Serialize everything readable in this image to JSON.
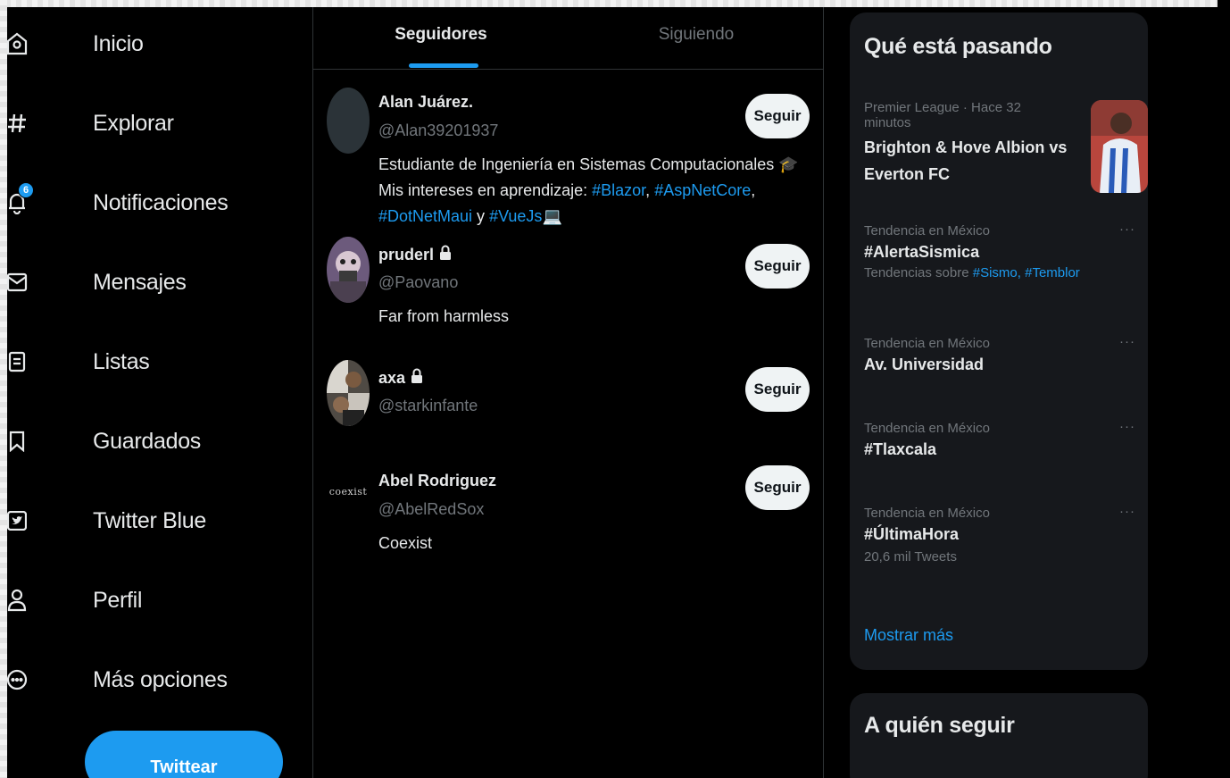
{
  "sidebar": {
    "items": [
      {
        "label": "Inicio",
        "icon": "home-icon"
      },
      {
        "label": "Explorar",
        "icon": "hashtag-icon"
      },
      {
        "label": "Notificaciones",
        "icon": "bell-icon",
        "badge": "6"
      },
      {
        "label": "Mensajes",
        "icon": "envelope-icon"
      },
      {
        "label": "Listas",
        "icon": "list-icon"
      },
      {
        "label": "Guardados",
        "icon": "bookmark-icon"
      },
      {
        "label": "Twitter Blue",
        "icon": "twitter-blue-icon"
      },
      {
        "label": "Perfil",
        "icon": "person-icon"
      },
      {
        "label": "Más opciones",
        "icon": "more-circle-icon"
      }
    ],
    "tweet_button": "Twittear"
  },
  "main": {
    "tabs": [
      {
        "label": "Seguidores",
        "active": true
      },
      {
        "label": "Siguiendo",
        "active": false
      }
    ],
    "users": [
      {
        "name": "Alan Juárez.",
        "handle": "@Alan39201937",
        "bio_parts": [
          "Estudiante de Ingeniería en Sistemas Computacionales 🎓 Mis intereses en aprendizaje: ",
          "#Blazor",
          ", ",
          "#AspNetCore",
          ", ",
          "#DotNetMaui",
          " y ",
          "#VueJs",
          "💻"
        ],
        "follow_label": "Seguir",
        "locked": false
      },
      {
        "name": "pruderl",
        "handle": "@Paovano",
        "bio": "Far from harmless",
        "follow_label": "Seguir",
        "locked": true
      },
      {
        "name": "axa",
        "handle": "@starkinfante",
        "bio": "",
        "follow_label": "Seguir",
        "locked": true
      },
      {
        "name": "Abel Rodriguez",
        "handle": "@AbelRedSox",
        "bio": "Coexist",
        "follow_label": "Seguir",
        "locked": false,
        "avatar_text": "coexist"
      }
    ]
  },
  "trends": {
    "title": "Qué está pasando",
    "items": [
      {
        "meta": "Premier League · Hace 32 minutos",
        "name": "Brighton & Hove Albion vs Everton FC",
        "has_image": true
      },
      {
        "meta": "Tendencia en México",
        "name": "#AlertaSismica",
        "sub_prefix": "Tendencias sobre ",
        "sub_tags": "#Sismo, #Temblor"
      },
      {
        "meta": "Tendencia en México",
        "name": "Av. Universidad"
      },
      {
        "meta": "Tendencia en México",
        "name": "#Tlaxcala"
      },
      {
        "meta": "Tendencia en México",
        "name": "#ÚltimaHora",
        "sub": "20,6 mil Tweets"
      }
    ],
    "more_dots": "···",
    "show_more": "Mostrar más"
  },
  "who_to_follow": {
    "title": "A quién seguir"
  },
  "colors": {
    "background": "#000000",
    "accent": "#1d9bf0",
    "card": "#16181c",
    "muted_text": "#71767b",
    "primary_text": "#e7e9ea"
  }
}
